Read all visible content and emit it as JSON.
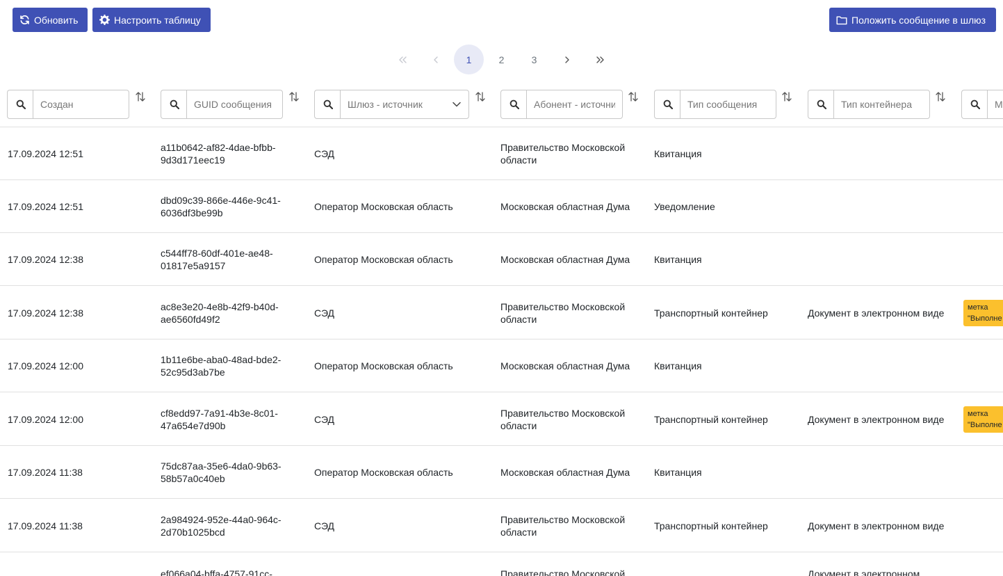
{
  "toolbar": {
    "refresh_label": "Обновить",
    "configure_label": "Настроить таблицу",
    "put_message_label": "Положить сообщение в шлюз"
  },
  "pagination": {
    "first": "«",
    "prev": "‹",
    "pages": [
      "1",
      "2",
      "3"
    ],
    "active_page": "1",
    "next": "›",
    "last": "»"
  },
  "filters": {
    "created_placeholder": "Создан",
    "guid_placeholder": "GUID сообщения",
    "gateway_placeholder": "Шлюз - источник",
    "subscriber_placeholder": "Абонент - источник",
    "msg_type_placeholder": "Тип сообщения",
    "container_type_placeholder": "Тип контейнера",
    "tags_placeholder": "Ме"
  },
  "rows": [
    {
      "created": "17.09.2024 12:51",
      "guid": "a11b0642-af82-4dae-bfbb-9d3d171eec19",
      "gateway": "СЭД",
      "subscriber": "Правительство Московской области",
      "msg_type": "Квитанция",
      "container": "",
      "tag": ""
    },
    {
      "created": "17.09.2024 12:51",
      "guid": "dbd09c39-866e-446e-9c41-6036df3be99b",
      "gateway": "Оператор Московская область",
      "subscriber": "Московская областная Дума",
      "msg_type": "Уведомление",
      "container": "",
      "tag": ""
    },
    {
      "created": "17.09.2024 12:38",
      "guid": "c544ff78-60df-401e-ae48-01817e5a9157",
      "gateway": "Оператор Московская область",
      "subscriber": "Московская областная Дума",
      "msg_type": "Квитанция",
      "container": "",
      "tag": ""
    },
    {
      "created": "17.09.2024 12:38",
      "guid": "ac8e3e20-4e8b-42f9-b40d-ae6560fd49f2",
      "gateway": "СЭД",
      "subscriber": "Правительство Московской области",
      "msg_type": "Транспортный контейнер",
      "container": "Документ в электронном виде",
      "tag": "метка \"Выполне"
    },
    {
      "created": "17.09.2024 12:00",
      "guid": "1b11e6be-aba0-48ad-bde2-52c95d3ab7be",
      "gateway": "Оператор Московская область",
      "subscriber": "Московская областная Дума",
      "msg_type": "Квитанция",
      "container": "",
      "tag": ""
    },
    {
      "created": "17.09.2024 12:00",
      "guid": "cf8edd97-7a91-4b3e-8c01-47a654e7d90b",
      "gateway": "СЭД",
      "subscriber": "Правительство Московской области",
      "msg_type": "Транспортный контейнер",
      "container": "Документ в электронном виде",
      "tag": "метка \"Выполне"
    },
    {
      "created": "17.09.2024 11:38",
      "guid": "75dc87aa-35e6-4da0-9b63-58b57a0c40eb",
      "gateway": "Оператор Московская область",
      "subscriber": "Московская областная Дума",
      "msg_type": "Квитанция",
      "container": "",
      "tag": ""
    },
    {
      "created": "17.09.2024 11:38",
      "guid": "2a984924-952e-44a0-964c-2d70b1025bcd",
      "gateway": "СЭД",
      "subscriber": "Правительство Московской области",
      "msg_type": "Транспортный контейнер",
      "container": "Документ в электронном виде",
      "tag": ""
    },
    {
      "created": "",
      "guid": "ef066a04-bffa-4757-91cc-",
      "gateway": "",
      "subscriber": "Правительство Московской",
      "msg_type": "",
      "container": "Документ в электронном",
      "tag": ""
    }
  ]
}
